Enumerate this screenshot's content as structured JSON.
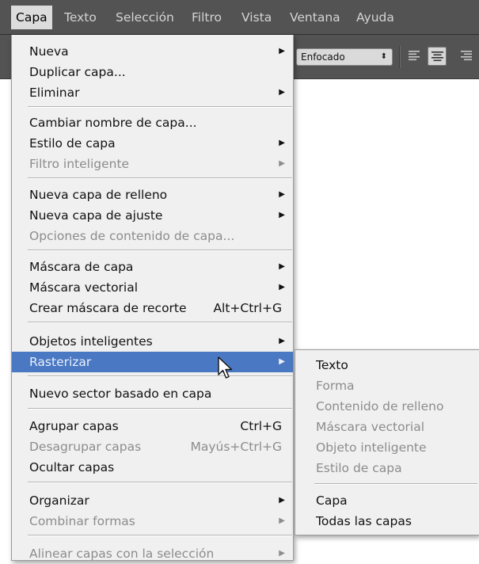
{
  "menubar": {
    "items": [
      {
        "label": "Capa",
        "active": true
      },
      {
        "label": "Texto"
      },
      {
        "label": "Selección"
      },
      {
        "label": "Filtro"
      },
      {
        "label": "Vista"
      },
      {
        "label": "Ventana"
      },
      {
        "label": "Ayuda"
      }
    ]
  },
  "options_bar": {
    "antialias_value": "Enfocado",
    "alignment_selected": "center"
  },
  "layer_menu": {
    "items": [
      {
        "label": "Nueva",
        "submenu": true
      },
      {
        "label": "Duplicar capa..."
      },
      {
        "label": "Eliminar",
        "submenu": true
      },
      {
        "label": "Cambiar nombre de capa..."
      },
      {
        "label": "Estilo de capa",
        "submenu": true
      },
      {
        "label": "Filtro inteligente",
        "submenu": true,
        "disabled": true
      },
      {
        "label": "Nueva capa de relleno",
        "submenu": true
      },
      {
        "label": "Nueva capa de ajuste",
        "submenu": true
      },
      {
        "label": "Opciones de contenido de capa...",
        "disabled": true
      },
      {
        "label": "Máscara de capa",
        "submenu": true
      },
      {
        "label": "Máscara vectorial",
        "submenu": true
      },
      {
        "label": "Crear máscara de recorte",
        "shortcut": "Alt+Ctrl+G"
      },
      {
        "label": "Objetos inteligentes",
        "submenu": true
      },
      {
        "label": "Rasterizar",
        "submenu": true,
        "highlighted": true
      },
      {
        "label": "Nuevo sector basado en capa"
      },
      {
        "label": "Agrupar capas",
        "shortcut": "Ctrl+G"
      },
      {
        "label": "Desagrupar capas",
        "shortcut": "Mayús+Ctrl+G",
        "disabled": true
      },
      {
        "label": "Ocultar capas"
      },
      {
        "label": "Organizar",
        "submenu": true
      },
      {
        "label": "Combinar formas",
        "submenu": true,
        "disabled": true
      },
      {
        "label": "Alinear capas con la selección",
        "submenu": true,
        "disabled": true
      }
    ]
  },
  "rasterize_submenu": {
    "items": [
      {
        "label": "Texto"
      },
      {
        "label": "Forma",
        "disabled": true
      },
      {
        "label": "Contenido de relleno",
        "disabled": true
      },
      {
        "label": "Máscara vectorial",
        "disabled": true
      },
      {
        "label": "Objeto inteligente",
        "disabled": true
      },
      {
        "label": "Estilo de capa",
        "disabled": true
      },
      {
        "label": "Capa"
      },
      {
        "label": "Todas las capas"
      }
    ]
  },
  "colors": {
    "menubar_bg": "#535353",
    "menu_bg": "#f0f0f0",
    "highlight": "#4a78c2",
    "disabled_text": "#8c8c8c"
  },
  "icons": {
    "submenu_arrow": "submenu-arrow-icon",
    "dropdown_arrows": "up-down-arrows-icon",
    "cursor": "mouse-pointer-icon"
  }
}
